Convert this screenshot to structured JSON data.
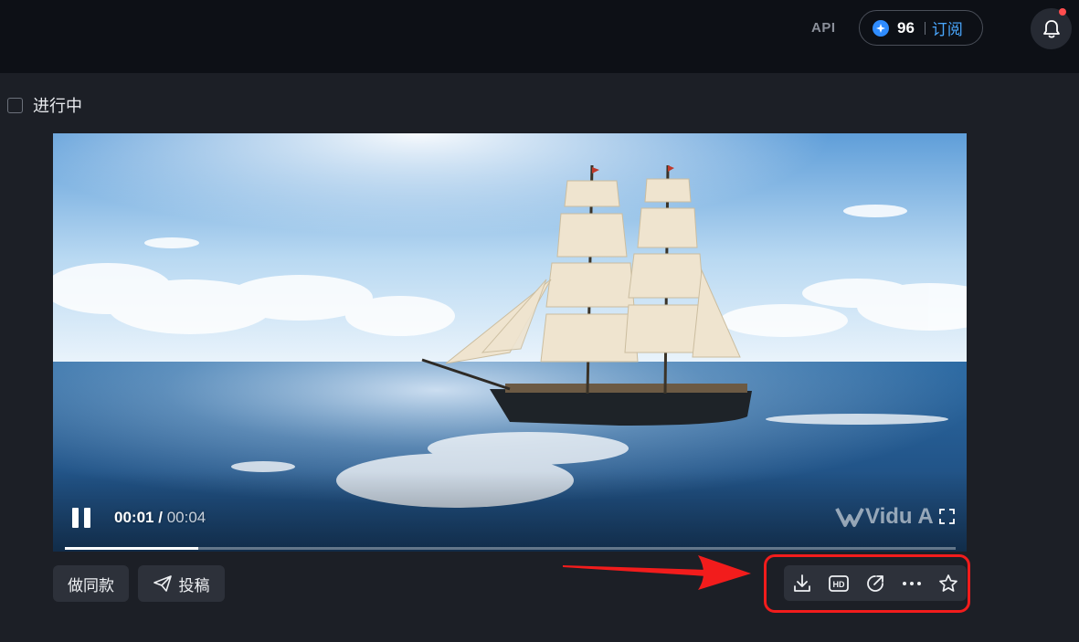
{
  "header": {
    "api_label": "API",
    "credits": "96",
    "subscribe_label": "订阅"
  },
  "task": {
    "status_label": "进行中"
  },
  "player": {
    "current_time": "00:01",
    "separator": "/",
    "total_time": "00:04",
    "progress": 0.15,
    "watermark": "Vidu A"
  },
  "actions": {
    "same_style_label": "做同款",
    "submit_label": "投稿"
  },
  "toolbar": {
    "tools": [
      "download-icon",
      "hd-icon",
      "share-icon",
      "more-icon",
      "star-icon"
    ]
  },
  "colors": {
    "accent": "#4aa8ff",
    "highlight": "#f21c1c",
    "notification": "#ff4d4f"
  }
}
